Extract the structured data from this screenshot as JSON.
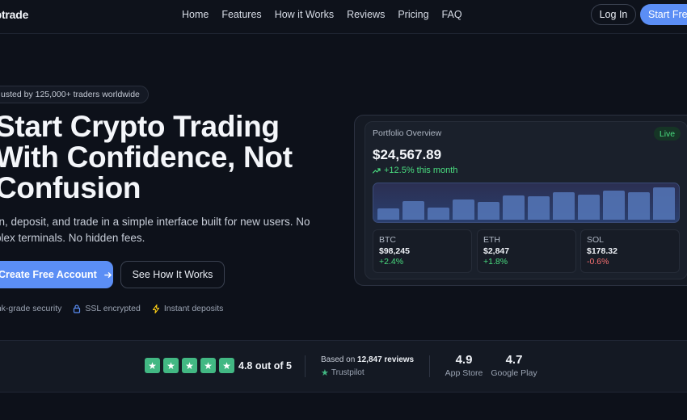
{
  "brand": {
    "logo": "yptrade"
  },
  "nav": {
    "links": [
      "Home",
      "Features",
      "How it Works",
      "Reviews",
      "Pricing",
      "FAQ"
    ],
    "login": "Log In",
    "start": "Start Free"
  },
  "hero": {
    "trust_pill": "usted by 125,000+ traders worldwide",
    "headline_lines": [
      "Start Crypto Trading",
      "With Confidence, Not",
      "Confusion"
    ],
    "sub_lines": [
      "rn, deposit, and trade in a simple interface built for new users. No",
      "plex terminals. No hidden fees."
    ],
    "cta_primary": "Create Free Account",
    "cta_primary_icon": "arrow-right-icon",
    "cta_secondary": "See How It Works",
    "features": [
      {
        "label": "ank-grade security",
        "icon": "none"
      },
      {
        "label": "SSL encrypted",
        "icon": "lock-icon"
      },
      {
        "label": "Instant deposits",
        "icon": "bolt-icon"
      }
    ]
  },
  "portfolio": {
    "label": "Portfolio Overview",
    "status": "Live",
    "amount": "$24,567.89",
    "change": "+12.5% this month",
    "change_icon": "trending-up-icon",
    "bars": [
      0.34,
      0.55,
      0.36,
      0.6,
      0.52,
      0.72,
      0.68,
      0.82,
      0.74,
      0.86,
      0.8,
      0.95
    ],
    "tickers": [
      {
        "symbol": "BTC",
        "price": "$98,245",
        "change": "+2.4%",
        "up": true
      },
      {
        "symbol": "ETH",
        "price": "$2,847",
        "change": "+1.8%",
        "up": true
      },
      {
        "symbol": "SOL",
        "price": "$178.32",
        "change": "-0.6%",
        "up": false
      }
    ]
  },
  "reviews": {
    "stars": 5,
    "rating": "4.8 out of 5",
    "based_prefix": "Based on",
    "based_count": "12,847 reviews",
    "trustpilot": "Trustpilot",
    "app_store": {
      "value": "4.9",
      "label": "App Store"
    },
    "google_play": {
      "value": "4.7",
      "label": "Google Play"
    }
  },
  "colors": {
    "accent": "#5b8ef5",
    "positive": "#4ade80",
    "negative": "#f87171",
    "star": "#42b883"
  }
}
